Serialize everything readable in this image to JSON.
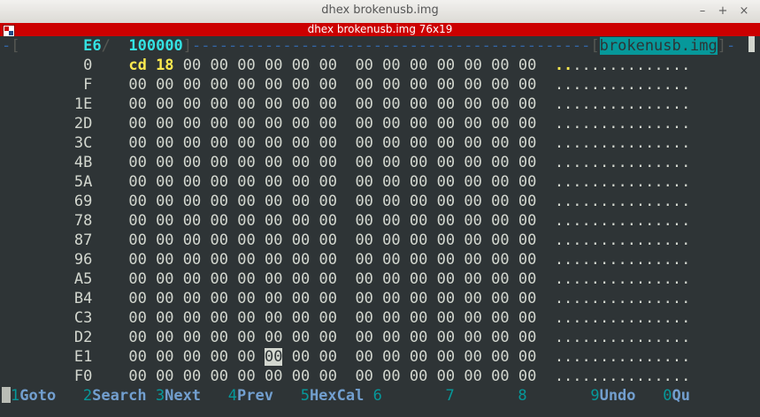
{
  "window": {
    "title": "dhex brokenusb.img",
    "tab_title": "dhex brokenusb.img 76x19",
    "minimize_glyph": "–",
    "maximize_glyph": "+",
    "close_glyph": "×"
  },
  "header": {
    "left_bracket": "[",
    "cursor_offset": "E6",
    "slash": "/",
    "file_size": "100000",
    "right_bracket": "]",
    "filename": "brokenusb.img"
  },
  "rows": [
    {
      "offset": "0",
      "bytes": [
        "cd",
        "18",
        "00",
        "00",
        "00",
        "00",
        "00",
        "00",
        "00",
        "00",
        "00",
        "00",
        "00",
        "00",
        "00"
      ],
      "ascii": "..............."
    },
    {
      "offset": "F",
      "bytes": [
        "00",
        "00",
        "00",
        "00",
        "00",
        "00",
        "00",
        "00",
        "00",
        "00",
        "00",
        "00",
        "00",
        "00",
        "00"
      ],
      "ascii": "..............."
    },
    {
      "offset": "1E",
      "bytes": [
        "00",
        "00",
        "00",
        "00",
        "00",
        "00",
        "00",
        "00",
        "00",
        "00",
        "00",
        "00",
        "00",
        "00",
        "00"
      ],
      "ascii": "..............."
    },
    {
      "offset": "2D",
      "bytes": [
        "00",
        "00",
        "00",
        "00",
        "00",
        "00",
        "00",
        "00",
        "00",
        "00",
        "00",
        "00",
        "00",
        "00",
        "00"
      ],
      "ascii": "..............."
    },
    {
      "offset": "3C",
      "bytes": [
        "00",
        "00",
        "00",
        "00",
        "00",
        "00",
        "00",
        "00",
        "00",
        "00",
        "00",
        "00",
        "00",
        "00",
        "00"
      ],
      "ascii": "..............."
    },
    {
      "offset": "4B",
      "bytes": [
        "00",
        "00",
        "00",
        "00",
        "00",
        "00",
        "00",
        "00",
        "00",
        "00",
        "00",
        "00",
        "00",
        "00",
        "00"
      ],
      "ascii": "..............."
    },
    {
      "offset": "5A",
      "bytes": [
        "00",
        "00",
        "00",
        "00",
        "00",
        "00",
        "00",
        "00",
        "00",
        "00",
        "00",
        "00",
        "00",
        "00",
        "00"
      ],
      "ascii": "..............."
    },
    {
      "offset": "69",
      "bytes": [
        "00",
        "00",
        "00",
        "00",
        "00",
        "00",
        "00",
        "00",
        "00",
        "00",
        "00",
        "00",
        "00",
        "00",
        "00"
      ],
      "ascii": "..............."
    },
    {
      "offset": "78",
      "bytes": [
        "00",
        "00",
        "00",
        "00",
        "00",
        "00",
        "00",
        "00",
        "00",
        "00",
        "00",
        "00",
        "00",
        "00",
        "00"
      ],
      "ascii": "..............."
    },
    {
      "offset": "87",
      "bytes": [
        "00",
        "00",
        "00",
        "00",
        "00",
        "00",
        "00",
        "00",
        "00",
        "00",
        "00",
        "00",
        "00",
        "00",
        "00"
      ],
      "ascii": "..............."
    },
    {
      "offset": "96",
      "bytes": [
        "00",
        "00",
        "00",
        "00",
        "00",
        "00",
        "00",
        "00",
        "00",
        "00",
        "00",
        "00",
        "00",
        "00",
        "00"
      ],
      "ascii": "..............."
    },
    {
      "offset": "A5",
      "bytes": [
        "00",
        "00",
        "00",
        "00",
        "00",
        "00",
        "00",
        "00",
        "00",
        "00",
        "00",
        "00",
        "00",
        "00",
        "00"
      ],
      "ascii": "..............."
    },
    {
      "offset": "B4",
      "bytes": [
        "00",
        "00",
        "00",
        "00",
        "00",
        "00",
        "00",
        "00",
        "00",
        "00",
        "00",
        "00",
        "00",
        "00",
        "00"
      ],
      "ascii": "..............."
    },
    {
      "offset": "C3",
      "bytes": [
        "00",
        "00",
        "00",
        "00",
        "00",
        "00",
        "00",
        "00",
        "00",
        "00",
        "00",
        "00",
        "00",
        "00",
        "00"
      ],
      "ascii": "..............."
    },
    {
      "offset": "D2",
      "bytes": [
        "00",
        "00",
        "00",
        "00",
        "00",
        "00",
        "00",
        "00",
        "00",
        "00",
        "00",
        "00",
        "00",
        "00",
        "00"
      ],
      "ascii": "..............."
    },
    {
      "offset": "E1",
      "bytes": [
        "00",
        "00",
        "00",
        "00",
        "00",
        "00",
        "00",
        "00",
        "00",
        "00",
        "00",
        "00",
        "00",
        "00",
        "00"
      ],
      "ascii": "..............."
    },
    {
      "offset": "F0",
      "bytes": [
        "00",
        "00",
        "00",
        "00",
        "00",
        "00",
        "00",
        "00",
        "00",
        "00",
        "00",
        "00",
        "00",
        "00",
        "00"
      ],
      "ascii": "..............."
    }
  ],
  "selection": {
    "row": 15,
    "col": 5
  },
  "function_keys": [
    {
      "num": "1",
      "label": "Goto"
    },
    {
      "num": "2",
      "label": "Search"
    },
    {
      "num": "3",
      "label": "Next"
    },
    {
      "num": "4",
      "label": "Prev"
    },
    {
      "num": "5",
      "label": "HexCal"
    },
    {
      "num": "6",
      "label": ""
    },
    {
      "num": "7",
      "label": ""
    },
    {
      "num": "8",
      "label": ""
    },
    {
      "num": "9",
      "label": "Undo"
    },
    {
      "num": "0",
      "label": "Qu"
    }
  ],
  "colors": {
    "terminal_bg": "#2e3436",
    "tab_red": "#cc0000",
    "hex_text": "#d3d7cf",
    "highlight_yellow": "#fce94f",
    "accent_cyan": "#34e2e2",
    "frame_blue": "#3465a4"
  }
}
